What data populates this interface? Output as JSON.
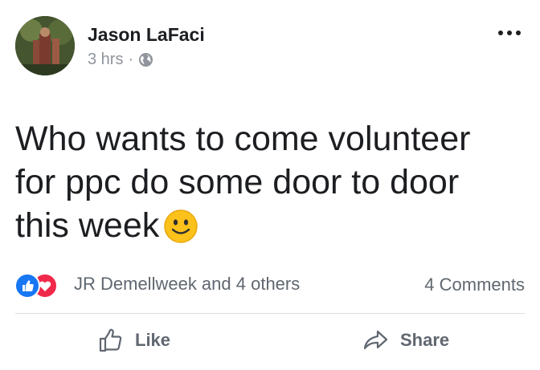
{
  "post": {
    "author": "Jason LaFaci",
    "timestamp": "3 hrs",
    "separator": "·",
    "privacy_icon": "globe-icon",
    "text": "Who wants to come volunteer for ppc do some door to door this week",
    "emoji": "slightly-smiling-face"
  },
  "reactions": {
    "types": [
      "like",
      "love"
    ],
    "summary": "JR Demellweek and 4 others",
    "comments": "4 Comments"
  },
  "actions": {
    "like_label": "Like",
    "share_label": "Share"
  },
  "colors": {
    "like_blue": "#1877f2",
    "love_red": "#f0284a",
    "text_primary": "#1c1e21",
    "text_secondary": "#606770",
    "divider": "#dadde1"
  }
}
